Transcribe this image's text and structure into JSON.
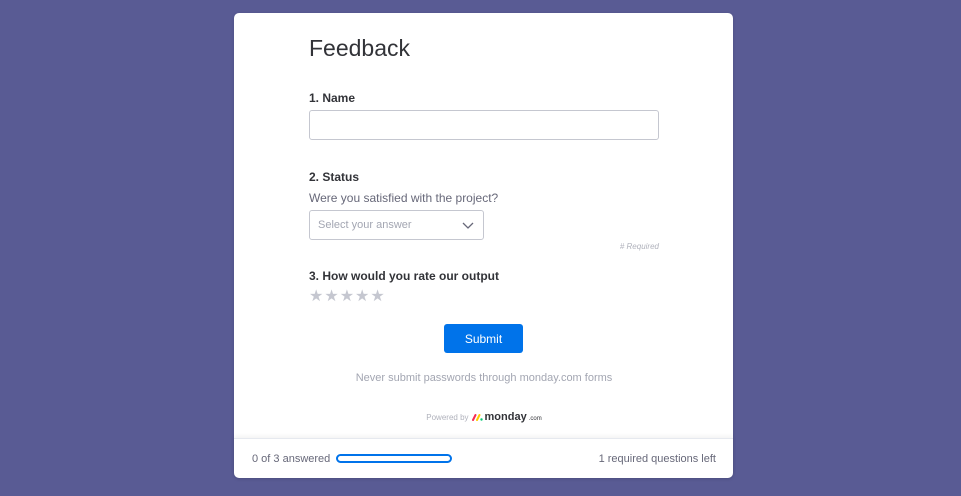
{
  "form": {
    "title": "Feedback",
    "questions": [
      {
        "label": "1. Name",
        "value": "",
        "placeholder": ""
      },
      {
        "label": "2. Status",
        "subtitle": "Were you satisfied with the project?",
        "placeholder": "Select your answer",
        "required_note": "# Required"
      },
      {
        "label": "3. How would you rate our output",
        "rating": 0,
        "max_rating": 5
      }
    ],
    "submit_label": "Submit",
    "warning": "Never submit passwords through monday.com forms",
    "powered_by": "Powered by",
    "brand_name": "monday",
    "brand_tld": ".com"
  },
  "footer": {
    "answered_text": "0 of 3 answered",
    "progress_fraction": 0,
    "remaining_text": "1 required questions left"
  },
  "colors": {
    "background": "#595b94",
    "primary": "#0073ea",
    "star_empty": "#c5c7d0"
  },
  "icons": {
    "select_chevron": "chevron-down-icon",
    "star": "star-icon",
    "brand_logo": "monday-logo-icon"
  }
}
